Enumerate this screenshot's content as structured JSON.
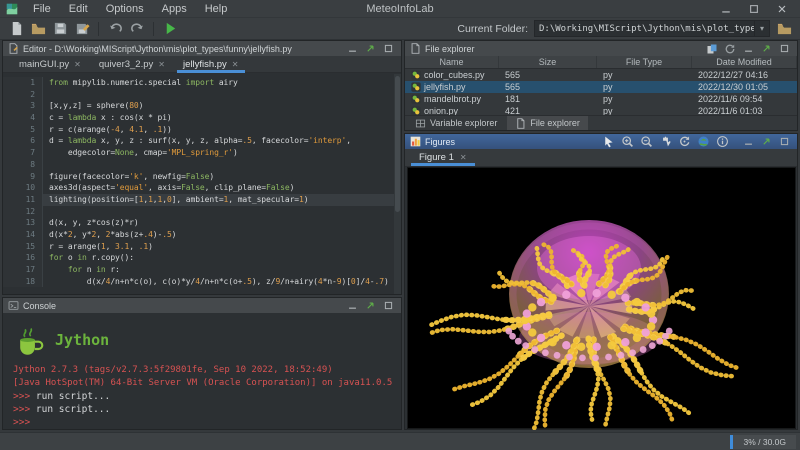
{
  "titlebar": {
    "app_title": "MeteoInfoLab",
    "menus": [
      "File",
      "Edit",
      "Options",
      "Apps",
      "Help"
    ],
    "window_controls": [
      "minimize",
      "maximize",
      "close"
    ]
  },
  "toolbar": {
    "icons": [
      "new-file",
      "open-folder",
      "save",
      "save-as",
      "undo",
      "redo",
      "run"
    ],
    "current_folder_label": "Current Folder:",
    "current_folder_path": "D:\\Working\\MIScript\\Jython\\mis\\plot_types\\funny"
  },
  "editor": {
    "panel_title": "Editor - D:\\Working\\MIScript\\Jython\\mis\\plot_types\\funny\\jellyfish.py",
    "tabs": [
      {
        "label": "mainGUI.py",
        "active": false
      },
      {
        "label": "quiver3_2.py",
        "active": false
      },
      {
        "label": "jellyfish.py",
        "active": true
      }
    ],
    "current_line": 11,
    "code_lines": [
      [
        [
          "k",
          "from"
        ],
        [
          "p",
          " mipylib.numeric.special "
        ],
        [
          "k",
          "import"
        ],
        [
          "p",
          " airy"
        ]
      ],
      [],
      [
        [
          "p",
          "[x,y,z] = sphere("
        ],
        [
          "n",
          "80"
        ],
        [
          "p",
          ")"
        ]
      ],
      [
        [
          "p",
          "c = "
        ],
        [
          "k",
          "lambda"
        ],
        [
          "p",
          " x : cos(x * pi)"
        ]
      ],
      [
        [
          "p",
          "r = c(arange("
        ],
        [
          "n",
          "-4"
        ],
        [
          "p",
          ", "
        ],
        [
          "n",
          "4.1"
        ],
        [
          "p",
          ", "
        ],
        [
          "n",
          ".1"
        ],
        [
          "p",
          "))"
        ]
      ],
      [
        [
          "p",
          "d = "
        ],
        [
          "k",
          "lambda"
        ],
        [
          "p",
          " x, y, z : surf(x, y, z, alpha="
        ],
        [
          "n",
          ".5"
        ],
        [
          "p",
          ", facecolor="
        ],
        [
          "s",
          "'interp'"
        ],
        [
          "p",
          ","
        ]
      ],
      [
        [
          "p",
          "    edgecolor="
        ],
        [
          "k",
          "None"
        ],
        [
          "p",
          ", cmap="
        ],
        [
          "s",
          "'MPL_spring_r'"
        ],
        [
          "p",
          ")"
        ]
      ],
      [],
      [
        [
          "p",
          "figure(facecolor="
        ],
        [
          "s",
          "'k'"
        ],
        [
          "p",
          ", newfig="
        ],
        [
          "k",
          "False"
        ],
        [
          "p",
          ")"
        ]
      ],
      [
        [
          "p",
          "axes3d(aspect="
        ],
        [
          "s",
          "'equal'"
        ],
        [
          "p",
          ", axis="
        ],
        [
          "k",
          "False"
        ],
        [
          "p",
          ", clip_plane="
        ],
        [
          "k",
          "False"
        ],
        [
          "p",
          ")"
        ]
      ],
      [
        [
          "p",
          "lighting(position=["
        ],
        [
          "n",
          "1"
        ],
        [
          "p",
          ","
        ],
        [
          "n",
          "1"
        ],
        [
          "p",
          ","
        ],
        [
          "n",
          "1"
        ],
        [
          "p",
          ","
        ],
        [
          "n",
          "0"
        ],
        [
          "p",
          "], ambient="
        ],
        [
          "n",
          "1"
        ],
        [
          "p",
          ", mat_specular="
        ],
        [
          "n",
          "1"
        ],
        [
          "p",
          ")"
        ]
      ],
      [],
      [
        [
          "p",
          "d(x, y, z*cos(z)*r)"
        ]
      ],
      [
        [
          "p",
          "d(x*"
        ],
        [
          "n",
          "2"
        ],
        [
          "p",
          ", y*"
        ],
        [
          "n",
          "2"
        ],
        [
          "p",
          ", "
        ],
        [
          "n",
          "2"
        ],
        [
          "p",
          "*abs(z+"
        ],
        [
          "n",
          ".4"
        ],
        [
          "p",
          ")-"
        ],
        [
          "n",
          ".5"
        ],
        [
          "p",
          ")"
        ]
      ],
      [
        [
          "p",
          "r = arange("
        ],
        [
          "n",
          "1"
        ],
        [
          "p",
          ", "
        ],
        [
          "n",
          "3.1"
        ],
        [
          "p",
          ", "
        ],
        [
          "n",
          ".1"
        ],
        [
          "p",
          ")"
        ]
      ],
      [
        [
          "k",
          "for"
        ],
        [
          "p",
          " o "
        ],
        [
          "k",
          "in"
        ],
        [
          "p",
          " r.copy():"
        ]
      ],
      [
        [
          "p",
          "    "
        ],
        [
          "k",
          "for"
        ],
        [
          "p",
          " n "
        ],
        [
          "k",
          "in"
        ],
        [
          "p",
          " r:"
        ]
      ],
      [
        [
          "p",
          "        d(x/"
        ],
        [
          "n",
          "4"
        ],
        [
          "p",
          "/n+n*c(o), c(o)*y/"
        ],
        [
          "n",
          "4"
        ],
        [
          "p",
          "/n+n*c(o+"
        ],
        [
          "n",
          ".5"
        ],
        [
          "p",
          "), z/"
        ],
        [
          "n",
          "9"
        ],
        [
          "p",
          "/n+airy("
        ],
        [
          "n",
          "4"
        ],
        [
          "p",
          "*n-"
        ],
        [
          "n",
          "9"
        ],
        [
          "p",
          ")["
        ],
        [
          "n",
          "0"
        ],
        [
          "p",
          "]/"
        ],
        [
          "n",
          "4"
        ],
        [
          "p",
          "-"
        ],
        [
          "n",
          ".7"
        ],
        [
          "p",
          ")"
        ]
      ]
    ]
  },
  "console": {
    "panel_title": "Console",
    "logo_text": "Jython",
    "banner": [
      "Jython 2.7.3 (tags/v2.7.3:5f29801fe, Sep 10 2022, 18:52:49)",
      "[Java HotSpot(TM) 64-Bit Server VM (Oracle Corporation)] on java11.0.5"
    ],
    "prompt_lines": [
      {
        "prompt": ">>>",
        "text": "run script..."
      },
      {
        "prompt": ">>>",
        "text": "run script..."
      },
      {
        "prompt": ">>>",
        "text": ""
      }
    ]
  },
  "file_explorer": {
    "panel_title": "File explorer",
    "title_icons": [
      "new-window",
      "refresh"
    ],
    "columns": [
      "Name",
      "Size",
      "File Type",
      "Date Modified"
    ],
    "rows": [
      {
        "name": "color_cubes.py",
        "size": "565",
        "type": "py",
        "modified": "2022/12/27 04:16",
        "selected": false
      },
      {
        "name": "jellyfish.py",
        "size": "565",
        "type": "py",
        "modified": "2022/12/30 01:05",
        "selected": true
      },
      {
        "name": "mandelbrot.py",
        "size": "181",
        "type": "py",
        "modified": "2022/11/6 09:54",
        "selected": false
      },
      {
        "name": "onion.py",
        "size": "421",
        "type": "py",
        "modified": "2022/11/6 01:03",
        "selected": false
      }
    ],
    "dock_tabs": [
      {
        "label": "Variable explorer",
        "icon": "grid",
        "active": false
      },
      {
        "label": "File explorer",
        "icon": "page",
        "active": true
      }
    ]
  },
  "figures": {
    "panel_title": "Figures",
    "tab_label": "Figure 1",
    "toolbar_icons": [
      "cursor",
      "zoom-in",
      "zoom-out",
      "pan",
      "rotate",
      "globe",
      "info"
    ],
    "figure": {
      "type": "3d-surface-jellyfish",
      "background": "#000000",
      "dome_colors": [
        "#ee52ee",
        "#d468c8",
        "#cfa163",
        "#d8aa50"
      ],
      "tentacle_count": 24,
      "tentacle_colors": [
        "#f5c93e",
        "#eeb52f",
        "#f0bf37"
      ],
      "ring_colors": [
        "#efa0d8",
        "#f3c93e"
      ],
      "outer_ring_color": "#eda6d6",
      "core_colors": [
        "#c3ba5b",
        "#958f41",
        "#d6cc6a",
        "#847e36",
        "#b0a74d",
        "#6f7c3a"
      ]
    }
  },
  "statusbar": {
    "memory": "3% / 30.0G"
  }
}
